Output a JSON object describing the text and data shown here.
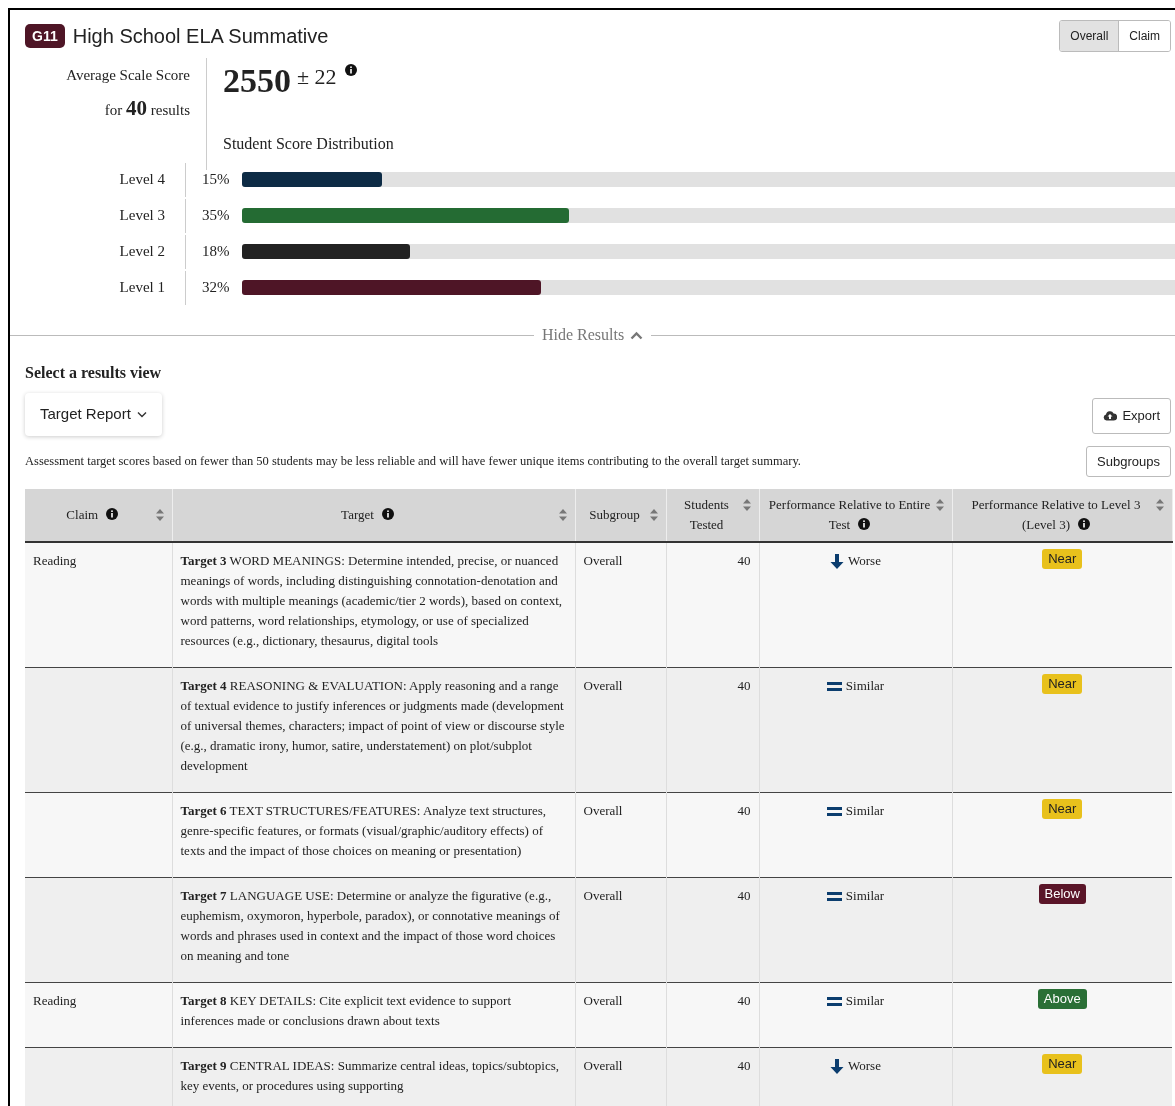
{
  "header": {
    "badge": "G11",
    "title": "High School ELA Summative",
    "view_toggle": [
      {
        "label": "Overall",
        "selected": true
      },
      {
        "label": "Claim",
        "selected": false
      }
    ]
  },
  "summary": {
    "label": "Average Scale Score",
    "count_prefix": "for",
    "count": "40",
    "count_suffix": "results",
    "score": "2550",
    "error": "± 22",
    "distribution_title": "Student Score Distribution",
    "levels": [
      {
        "label": "Level 4",
        "percent": "15%",
        "level": 0.15,
        "color": "#0d2b45"
      },
      {
        "label": "Level 3",
        "percent": "35%",
        "level": 0.35,
        "color": "#246b33"
      },
      {
        "label": "Level 2",
        "percent": "18%",
        "level": 0.18,
        "color": "#222222"
      },
      {
        "label": "Level 1",
        "percent": "32%",
        "level": 0.32,
        "color": "#4e1526"
      }
    ]
  },
  "hide_results": "Hide Results",
  "results_view": {
    "heading": "Select a results view",
    "dropdown": "Target Report"
  },
  "export_button": "Export",
  "note": "Assessment target scores based on fewer than 50 students may be less reliable and will have fewer unique items contributing to the overall target summary.",
  "subgroups_button": "Subgroups",
  "table": {
    "columns": [
      {
        "label": "Claim",
        "info": true
      },
      {
        "label": "Target",
        "info": true
      },
      {
        "label": "Subgroup",
        "info": false
      },
      {
        "label": "Students Tested",
        "info": false
      },
      {
        "label": "Performance Relative to Entire Test",
        "info": true
      },
      {
        "label": "Performance Relative to Level 3 (Level 3)",
        "info": true
      }
    ],
    "rows": [
      {
        "claim": "Reading",
        "target": "**Target 3** WORD MEANINGS: Determine intended, precise, or nuanced meanings of words, including distinguishing connotation-denotation and words with multiple meanings (academic/tier 2 words), based on context, word patterns, word relationships, etymology, or use of specialized resources (e.g., dictionary, thesaurus, digital tools",
        "subgroup": "Overall",
        "tested": "40",
        "trend": {
          "kind": "worse",
          "label": "Worse"
        },
        "badge": {
          "kind": "near",
          "label": "Near"
        }
      },
      {
        "target": "**Target 4** REASONING & EVALUATION: Apply reasoning and a range of textual evidence to justify inferences or judgments made (development of universal themes, characters; impact of point of view or discourse style (e.g., dramatic irony, humor, satire, understatement) on plot/subplot development",
        "subgroup": "Overall",
        "tested": "40",
        "trend": {
          "kind": "similar",
          "label": "Similar"
        },
        "badge": {
          "kind": "near",
          "label": "Near"
        }
      },
      {
        "target": "**Target 6** TEXT STRUCTURES/FEATURES: Analyze text structures, genre-specific features, or formats (visual/graphic/auditory effects) of texts and the impact of those choices on meaning or presentation)",
        "subgroup": "Overall",
        "tested": "40",
        "trend": {
          "kind": "similar",
          "label": "Similar"
        },
        "badge": {
          "kind": "near",
          "label": "Near"
        }
      },
      {
        "target": "**Target 7** LANGUAGE USE: Determine or analyze the figurative (e.g., euphemism, oxymoron, hyperbole, paradox), or connotative meanings of words and phrases used in context and the impact of those word choices on meaning and tone",
        "subgroup": "Overall",
        "tested": "40",
        "trend": {
          "kind": "similar",
          "label": "Similar"
        },
        "badge": {
          "kind": "below",
          "label": "Below"
        }
      },
      {
        "claim": "Reading",
        "target": "**Target 8** KEY DETAILS: Cite explicit text evidence to support inferences made or conclusions drawn about texts",
        "subgroup": "Overall",
        "tested": "40",
        "trend": {
          "kind": "similar",
          "label": "Similar"
        },
        "badge": {
          "kind": "above",
          "label": "Above"
        }
      },
      {
        "target": "**Target 9** CENTRAL IDEAS: Summarize central ideas, topics/subtopics, key events, or procedures using supporting",
        "subgroup": "Overall",
        "tested": "40",
        "trend": {
          "kind": "worse",
          "label": "Worse"
        },
        "badge": {
          "kind": "near",
          "label": "Near"
        }
      }
    ]
  }
}
